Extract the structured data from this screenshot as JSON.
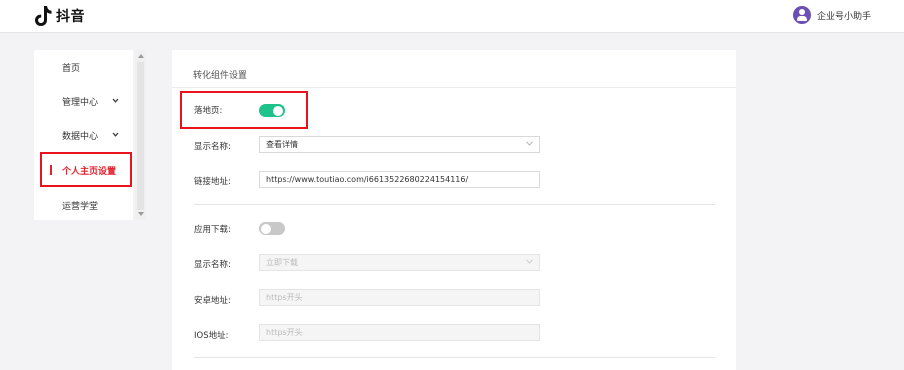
{
  "header": {
    "logo_text": "抖音",
    "user_name": "企业号小助手"
  },
  "sidebar": {
    "items": [
      {
        "label": "首页"
      },
      {
        "label": "管理中心"
      },
      {
        "label": "数据中心"
      },
      {
        "label": "个人主页设置"
      },
      {
        "label": "运营学堂"
      }
    ]
  },
  "panel": {
    "title": "转化组件设置",
    "landing": {
      "toggle_label": "落地页:",
      "toggle_on": true,
      "name_label": "显示名称:",
      "name_value": "查看详情",
      "link_label": "链接地址:",
      "link_value": "https://www.toutiao.com/i6613522680224154116/"
    },
    "app": {
      "toggle_label": "应用下载:",
      "toggle_on": false,
      "name_label": "显示名称:",
      "name_value": "立即下载",
      "android_label": "安卓地址:",
      "android_placeholder": "https开头",
      "ios_label": "IOS地址:",
      "ios_placeholder": "https开头"
    }
  },
  "colors": {
    "accent_red": "#e2222f",
    "toggle_on": "#1ec28b",
    "highlight_box": "#e8131f"
  }
}
